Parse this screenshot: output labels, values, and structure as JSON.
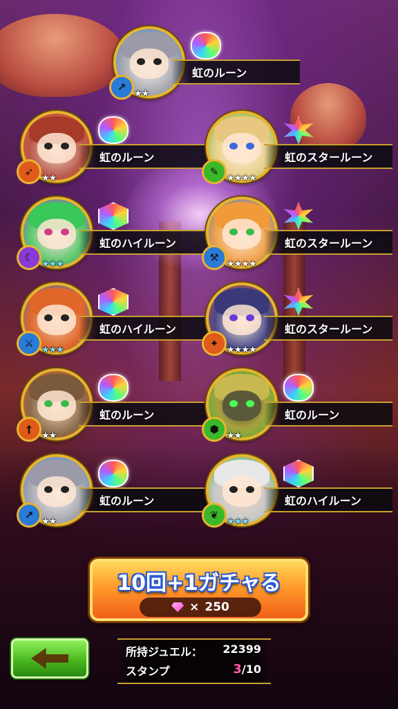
{
  "rewards": [
    {
      "rune": "虹のルーン",
      "gem_shape": "round",
      "stars": "★★",
      "star_color": "white",
      "element_icon": "wind-icon",
      "portrait": "white-cat-monster",
      "ring_color": "#2a7ad8"
    },
    {
      "rune": "虹のルーン",
      "gem_shape": "round",
      "stars": "★★",
      "star_color": "white",
      "element_icon": "fire-icon",
      "portrait": "owl-monster",
      "ring_color": "#e05a1a"
    },
    {
      "rune": "虹のスタールーン",
      "gem_shape": "star",
      "stars": "★★★★",
      "star_color": "white",
      "element_icon": "wood-icon",
      "portrait": "blonde-heroine",
      "ring_color": "#3ab82a"
    },
    {
      "rune": "虹のハイルーン",
      "gem_shape": "hex",
      "stars": "★★★",
      "star_color": "blue",
      "element_icon": "dark-icon",
      "portrait": "green-hair-girl",
      "ring_color": "#8a3ad8"
    },
    {
      "rune": "虹のスタールーン",
      "gem_shape": "star",
      "stars": "★★★★",
      "star_color": "white",
      "element_icon": "water-icon",
      "portrait": "fox-girl",
      "ring_color": "#2a7ad8"
    },
    {
      "rune": "虹のハイルーン",
      "gem_shape": "hex",
      "stars": "★★★",
      "star_color": "blue",
      "element_icon": "water-icon",
      "portrait": "bandana-warrior",
      "ring_color": "#2a7ad8"
    },
    {
      "rune": "虹のスタールーン",
      "gem_shape": "star",
      "stars": "★★★★",
      "star_color": "white",
      "element_icon": "fire-icon",
      "portrait": "witch-girl",
      "ring_color": "#e05a1a"
    },
    {
      "rune": "虹のルーン",
      "gem_shape": "round",
      "stars": "★★",
      "star_color": "white",
      "element_icon": "fire-icon",
      "portrait": "fox-monster",
      "ring_color": "#e05a1a"
    },
    {
      "rune": "虹のルーン",
      "gem_shape": "round",
      "stars": "★★",
      "star_color": "white",
      "element_icon": "wood-icon",
      "portrait": "green-armor-knight",
      "ring_color": "#3ab82a"
    },
    {
      "rune": "虹のルーン",
      "gem_shape": "round",
      "stars": "★★",
      "star_color": "white",
      "element_icon": "water-icon",
      "portrait": "white-cat-monster",
      "ring_color": "#2a7ad8"
    },
    {
      "rune": "虹のハイルーン",
      "gem_shape": "hex",
      "stars": "★★★",
      "star_color": "blue",
      "element_icon": "wood-icon",
      "portrait": "old-sage",
      "ring_color": "#3ab82a"
    }
  ],
  "gacha_button": {
    "label": "10回+1ガチャる",
    "cost_prefix": "×",
    "cost": "250",
    "cost_icon": "jewel-icon",
    "color": "#ff9a2a"
  },
  "back_button": {
    "icon": "arrow-left-icon",
    "color": "#4ab820"
  },
  "info": {
    "jewel_label": "所持ジュエル：",
    "jewel_value": "22399",
    "stamp_label": "スタンプ",
    "stamp_current": "3",
    "stamp_total": "/10"
  }
}
